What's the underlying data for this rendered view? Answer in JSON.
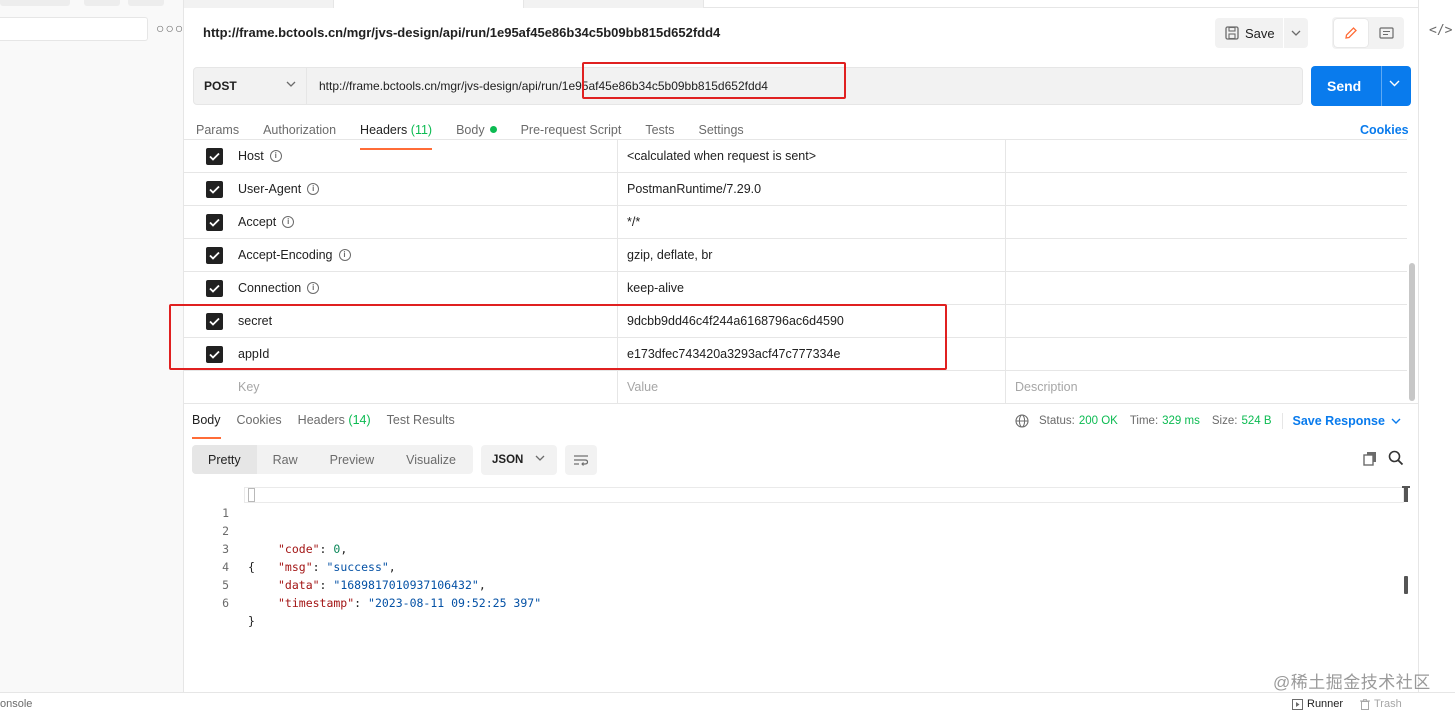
{
  "request": {
    "title": "http://frame.bctools.cn/mgr/jvs-design/api/run/1e95af45e86b34c5b09bb815d652fdd4",
    "save_label": "Save",
    "method": "POST",
    "url": "http://frame.bctools.cn/mgr/jvs-design/api/run/1e95af45e86b34c5b09bb815d652fdd4",
    "send_label": "Send",
    "cookies_label": "Cookies"
  },
  "request_tabs": {
    "params": "Params",
    "authorization": "Authorization",
    "headers": "Headers",
    "headers_count": "(11)",
    "body": "Body",
    "pre_request": "Pre-request Script",
    "tests": "Tests",
    "settings": "Settings"
  },
  "headers_rows": [
    {
      "key": "Host",
      "value": "<calculated when request is sent>",
      "info": true
    },
    {
      "key": "User-Agent",
      "value": "PostmanRuntime/7.29.0",
      "info": true
    },
    {
      "key": "Accept",
      "value": "*/*",
      "info": true
    },
    {
      "key": "Accept-Encoding",
      "value": "gzip, deflate, br",
      "info": true
    },
    {
      "key": "Connection",
      "value": "keep-alive",
      "info": true
    },
    {
      "key": "secret",
      "value": "9dcbb9dd46c4f244a6168796ac6d4590",
      "info": false
    },
    {
      "key": "appId",
      "value": "e173dfec743420a3293acf47c777334e",
      "info": false
    }
  ],
  "headers_placeholders": {
    "key": "Key",
    "value": "Value",
    "description": "Description"
  },
  "response_tabs": {
    "body": "Body",
    "cookies": "Cookies",
    "headers": "Headers",
    "headers_count": "(14)",
    "test_results": "Test Results"
  },
  "status": {
    "status_label": "Status:",
    "status_value": "200 OK",
    "time_label": "Time:",
    "time_value": "329 ms",
    "size_label": "Size:",
    "size_value": "524 B",
    "save_response": "Save Response"
  },
  "view_tabs": {
    "pretty": "Pretty",
    "raw": "Raw",
    "preview": "Preview",
    "visualize": "Visualize",
    "format": "JSON"
  },
  "code": {
    "line_numbers": [
      "1",
      "2",
      "3",
      "4",
      "5",
      "6"
    ],
    "open_brace": "{",
    "close_brace": "}",
    "code_key": "\"code\"",
    "code_value": "0",
    "msg_key": "\"msg\"",
    "msg_value": "\"success\"",
    "data_key": "\"data\"",
    "data_value": "\"1689817010937106432\"",
    "timestamp_key": "\"timestamp\"",
    "timestamp_value": "\"2023-08-11 09:52:25 397\""
  },
  "bottom": {
    "console": "onsole",
    "runner": "Runner",
    "trash": "Trash",
    "watermark": "@稀土掘金技术社区"
  },
  "colors": {
    "accent_orange": "#ff6c37",
    "send_blue": "#097bed",
    "success_green": "#0cbb52",
    "highlight_red": "#e02020"
  }
}
